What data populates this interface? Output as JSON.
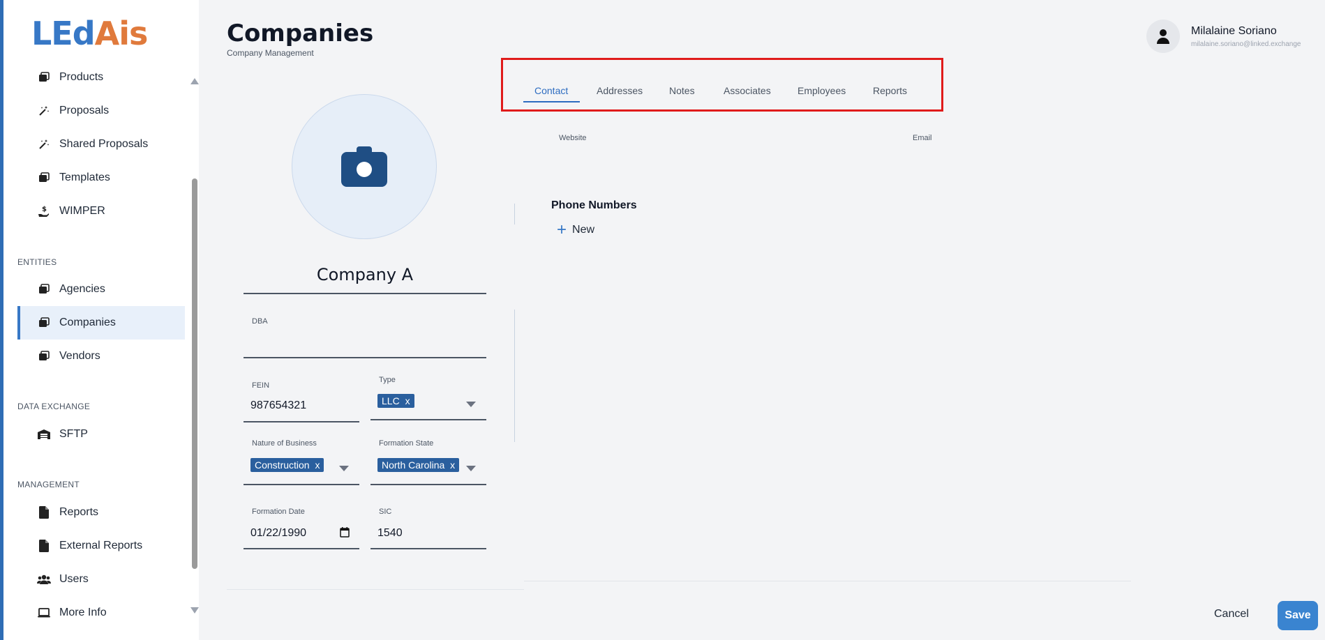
{
  "brand": {
    "logo_part1": "LEd",
    "logo_part2": "Ais"
  },
  "sidebar": {
    "items_top": [
      {
        "label": "Products",
        "icon": "stack-icon"
      },
      {
        "label": "Proposals",
        "icon": "magic-wand-icon"
      },
      {
        "label": "Shared Proposals",
        "icon": "magic-wand-icon"
      },
      {
        "label": "Templates",
        "icon": "stack-icon"
      },
      {
        "label": "WIMPER",
        "icon": "hand-dollar-icon"
      }
    ],
    "section_entities": "ENTITIES",
    "items_entities": [
      {
        "label": "Agencies",
        "icon": "stack-icon"
      },
      {
        "label": "Companies",
        "icon": "stack-icon",
        "active": true
      },
      {
        "label": "Vendors",
        "icon": "stack-icon"
      }
    ],
    "section_data_exchange": "DATA EXCHANGE",
    "items_data_exchange": [
      {
        "label": "SFTP",
        "icon": "warehouse-icon"
      }
    ],
    "section_management": "MANAGEMENT",
    "items_management": [
      {
        "label": "Reports",
        "icon": "file-icon"
      },
      {
        "label": "External Reports",
        "icon": "file-icon"
      },
      {
        "label": "Users",
        "icon": "users-icon"
      },
      {
        "label": "More Info",
        "icon": "laptop-icon"
      }
    ]
  },
  "header": {
    "title": "Companies",
    "subtitle": "Company Management",
    "user_name": "Milalaine Soriano",
    "user_email": "milalaine.soriano@linked.exchange"
  },
  "company": {
    "name": "Company A",
    "dba_label": "DBA",
    "dba_value": "",
    "fein_label": "FEIN",
    "fein_value": "987654321",
    "type_label": "Type",
    "type_chip": "LLC",
    "nature_label": "Nature of Business",
    "nature_chip": "Construction",
    "state_label": "Formation State",
    "state_chip": "North Carolina",
    "date_label": "Formation Date",
    "date_value": "01/22/1990",
    "sic_label": "SIC",
    "sic_value": "1540",
    "chip_remove": "x"
  },
  "tabs": [
    "Contact",
    "Addresses",
    "Notes",
    "Associates",
    "Employees",
    "Reports"
  ],
  "active_tab": "Contact",
  "contact": {
    "website_label": "Website",
    "email_label": "Email",
    "phone_section": "Phone Numbers",
    "new_label": "New"
  },
  "footer": {
    "cancel": "Cancel",
    "save": "Save"
  },
  "colors": {
    "brand_blue": "#3778c6",
    "brand_orange": "#e07a3c",
    "chip": "#2a5f9e",
    "highlight": "#e01b1b",
    "save": "#3a84d0"
  }
}
